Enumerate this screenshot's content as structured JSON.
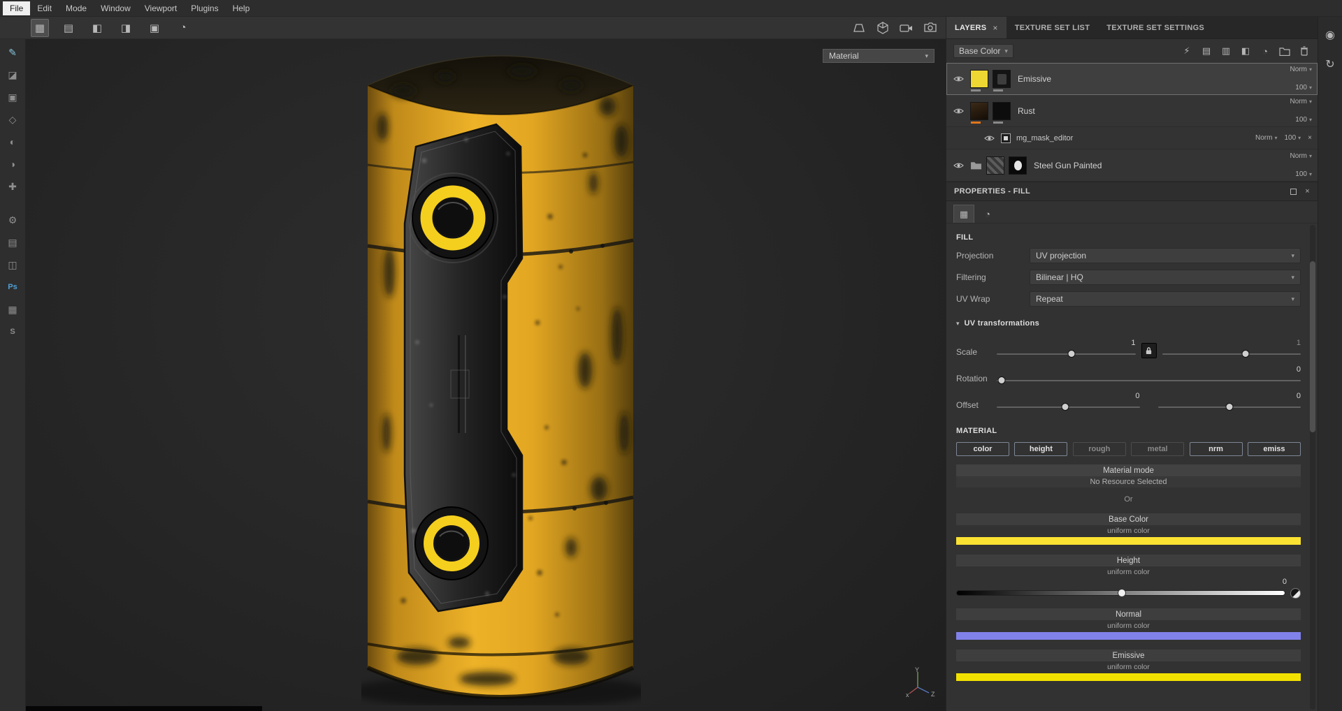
{
  "menu": {
    "file": "File",
    "edit": "Edit",
    "mode": "Mode",
    "window": "Window",
    "viewport": "Viewport",
    "plugins": "Plugins",
    "help": "Help"
  },
  "viewport": {
    "shading_mode": "Material",
    "axis_x": "x",
    "axis_y": "Y",
    "axis_z": "Z"
  },
  "dock": {
    "tab_layers": "LAYERS",
    "tab_texture_set_list": "TEXTURE SET LIST",
    "tab_texture_set_settings": "TEXTURE SET SETTINGS"
  },
  "layers_panel": {
    "channel_filter": "Base Color",
    "rows": [
      {
        "name": "Emissive",
        "blend": "Norm",
        "opacity": "100"
      },
      {
        "name": "Rust",
        "blend": "Norm",
        "opacity": "100"
      },
      {
        "name": "mg_mask_editor",
        "blend": "Norm",
        "opacity": "100"
      },
      {
        "name": "Steel Gun Painted",
        "blend": "Norm",
        "opacity": "100"
      }
    ]
  },
  "properties": {
    "title": "PROPERTIES - FILL",
    "fill": {
      "title": "FILL",
      "projection_label": "Projection",
      "projection_value": "UV projection",
      "filtering_label": "Filtering",
      "filtering_value": "Bilinear | HQ",
      "uvwrap_label": "UV Wrap",
      "uvwrap_value": "Repeat"
    },
    "uv": {
      "title": "UV transformations",
      "scale_label": "Scale",
      "scale_x": "1",
      "scale_y": "1",
      "rotation_label": "Rotation",
      "rotation_value": "0",
      "offset_label": "Offset",
      "offset_x": "0",
      "offset_y": "0"
    },
    "material": {
      "title": "MATERIAL",
      "channels": [
        {
          "label": "color"
        },
        {
          "label": "height"
        },
        {
          "label": "rough"
        },
        {
          "label": "metal"
        },
        {
          "label": "nrm"
        },
        {
          "label": "emiss"
        }
      ],
      "mode_title": "Material mode",
      "mode_status": "No Resource Selected",
      "or_text": "Or",
      "base_color": {
        "title": "Base Color",
        "mode": "uniform color",
        "swatch": "#fbe232"
      },
      "height": {
        "title": "Height",
        "mode": "uniform color",
        "value": "0"
      },
      "normal": {
        "title": "Normal",
        "mode": "uniform color",
        "swatch": "#8181ea"
      },
      "emissive": {
        "title": "Emissive",
        "mode": "uniform color",
        "swatch": "#f2e100"
      }
    }
  },
  "icons": {
    "chevron_down": "▾",
    "close": "×",
    "toolbar": [
      "▦",
      "▤",
      "◧",
      "◨",
      "▣",
      "◔"
    ],
    "sidebar": [
      "✎",
      "◪",
      "▣",
      "◇",
      "◐",
      "◑",
      "✚",
      "⚙",
      "▤",
      "◫",
      "Ps",
      "▦",
      "S"
    ],
    "layer_actions": [
      "⚡",
      "▤",
      "▥",
      "◧",
      "◔"
    ],
    "props_tabs": [
      "▦",
      "◔"
    ],
    "strip": [
      "◉",
      "↻"
    ]
  }
}
